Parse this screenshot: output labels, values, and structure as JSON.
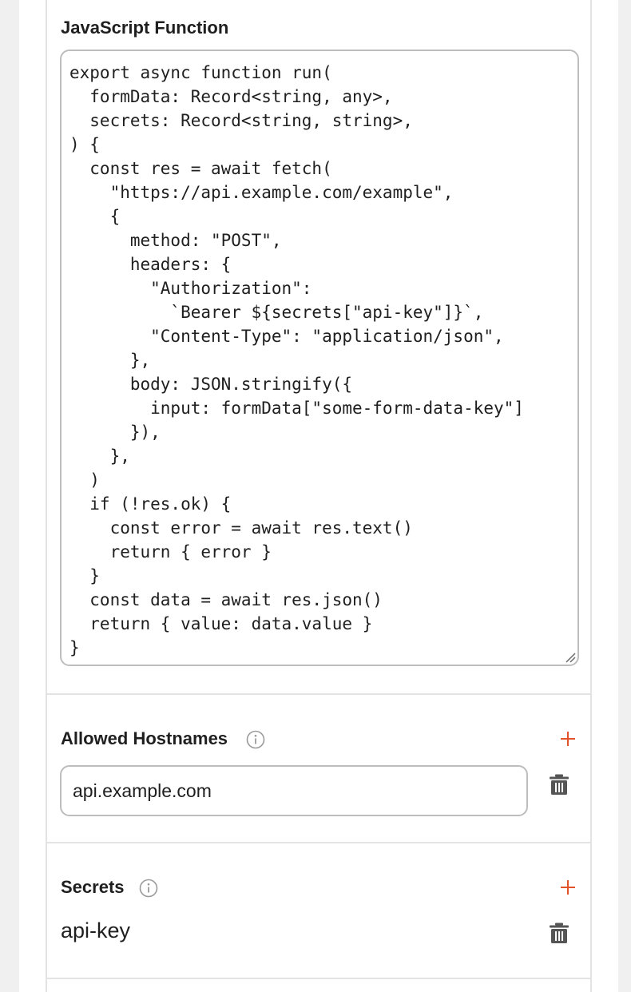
{
  "js_function": {
    "title": "JavaScript Function",
    "code": "export async function run(\n  formData: Record<string, any>,\n  secrets: Record<string, string>,\n) {\n  const res = await fetch(\n    \"https://api.example.com/example\",\n    {\n      method: \"POST\",\n      headers: {\n        \"Authorization\":\n          `Bearer ${secrets[\"api-key\"]}`,\n        \"Content-Type\": \"application/json\",\n      },\n      body: JSON.stringify({\n        input: formData[\"some-form-data-key\"]\n      }),\n    },\n  )\n  if (!res.ok) {\n    const error = await res.text()\n    return { error }\n  }\n  const data = await res.json()\n  return { value: data.value }\n}"
  },
  "allowed_hostnames": {
    "title": "Allowed Hostnames",
    "items": [
      {
        "value": "api.example.com"
      }
    ]
  },
  "secrets": {
    "title": "Secrets",
    "items": [
      {
        "name": "api-key"
      }
    ]
  },
  "colors": {
    "accent": "#e0532b",
    "text": "#1f1f1f",
    "border": "#bdbdbd",
    "divider": "#e3e3e3",
    "icon_gray": "#9a9a9a",
    "page_bg": "#f0f0f0"
  }
}
